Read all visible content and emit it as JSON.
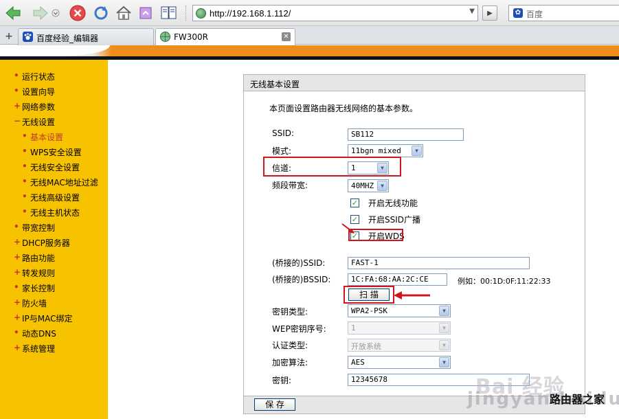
{
  "browser": {
    "address": "http://192.168.1.112/",
    "search_placeholder": "百度",
    "tabs": [
      {
        "label": "百度经验_编辑器"
      },
      {
        "label": "FW300R"
      }
    ]
  },
  "sidebar": {
    "items": [
      {
        "label": "运行状态",
        "bullet": "•"
      },
      {
        "label": "设置向导",
        "bullet": "•"
      },
      {
        "label": "网络参数",
        "bullet": "+"
      },
      {
        "label": "无线设置",
        "bullet": "−"
      },
      {
        "label": "基本设置",
        "bullet": "•"
      },
      {
        "label": "WPS安全设置",
        "bullet": "•"
      },
      {
        "label": "无线安全设置",
        "bullet": "•"
      },
      {
        "label": "无线MAC地址过滤",
        "bullet": "•"
      },
      {
        "label": "无线高级设置",
        "bullet": "•"
      },
      {
        "label": "无线主机状态",
        "bullet": "•"
      },
      {
        "label": "带宽控制",
        "bullet": "•"
      },
      {
        "label": "DHCP服务器",
        "bullet": "+"
      },
      {
        "label": "路由功能",
        "bullet": "+"
      },
      {
        "label": "转发规则",
        "bullet": "+"
      },
      {
        "label": "家长控制",
        "bullet": "•"
      },
      {
        "label": "防火墙",
        "bullet": "+"
      },
      {
        "label": "IP与MAC绑定",
        "bullet": "+"
      },
      {
        "label": "动态DNS",
        "bullet": "•"
      },
      {
        "label": "系统管理",
        "bullet": "+"
      }
    ]
  },
  "panel": {
    "title": "无线基本设置",
    "intro": "本页面设置路由器无线网络的基本参数。",
    "ssid": {
      "label": "SSID:",
      "value": "SB112"
    },
    "mode": {
      "label": "模式:",
      "value": "11bgn mixed"
    },
    "channel": {
      "label": "信道:",
      "value": "1"
    },
    "bandwidth": {
      "label": "频段带宽:",
      "value": "40MHZ"
    },
    "checkboxes": {
      "wireless": {
        "label": "开启无线功能",
        "checked": true
      },
      "ssid_broadcast": {
        "label": "开启SSID广播",
        "checked": true
      },
      "wds": {
        "label": "开启WDS",
        "checked": true
      }
    },
    "bridge_ssid": {
      "label": "(桥接的)SSID:",
      "value": "FAST-1"
    },
    "bridge_bssid": {
      "label": "(桥接的)BSSID:",
      "value": "1C:FA:68:AA:2C:CE",
      "example": "例如：00:1D:0F:11:22:33"
    },
    "scan_button": "扫 描",
    "key_type": {
      "label": "密钥类型:",
      "value": "WPA2-PSK"
    },
    "wep_index": {
      "label": "WEP密钥序号:",
      "value": "1"
    },
    "auth_type": {
      "label": "认证类型:",
      "value": "开放系统"
    },
    "encryption": {
      "label": "加密算法:",
      "value": "AES"
    },
    "key": {
      "label": "密钥:",
      "value": "12345678"
    },
    "save_button": "保 存"
  },
  "watermark": {
    "line1": "Bai 经验",
    "line2": "jingyan.baidu",
    "line3": "路由器之家"
  },
  "colors": {
    "sidebar": "#f7c200",
    "banner_orange": "#f08c1a",
    "highlight_red": "#d2141e"
  }
}
